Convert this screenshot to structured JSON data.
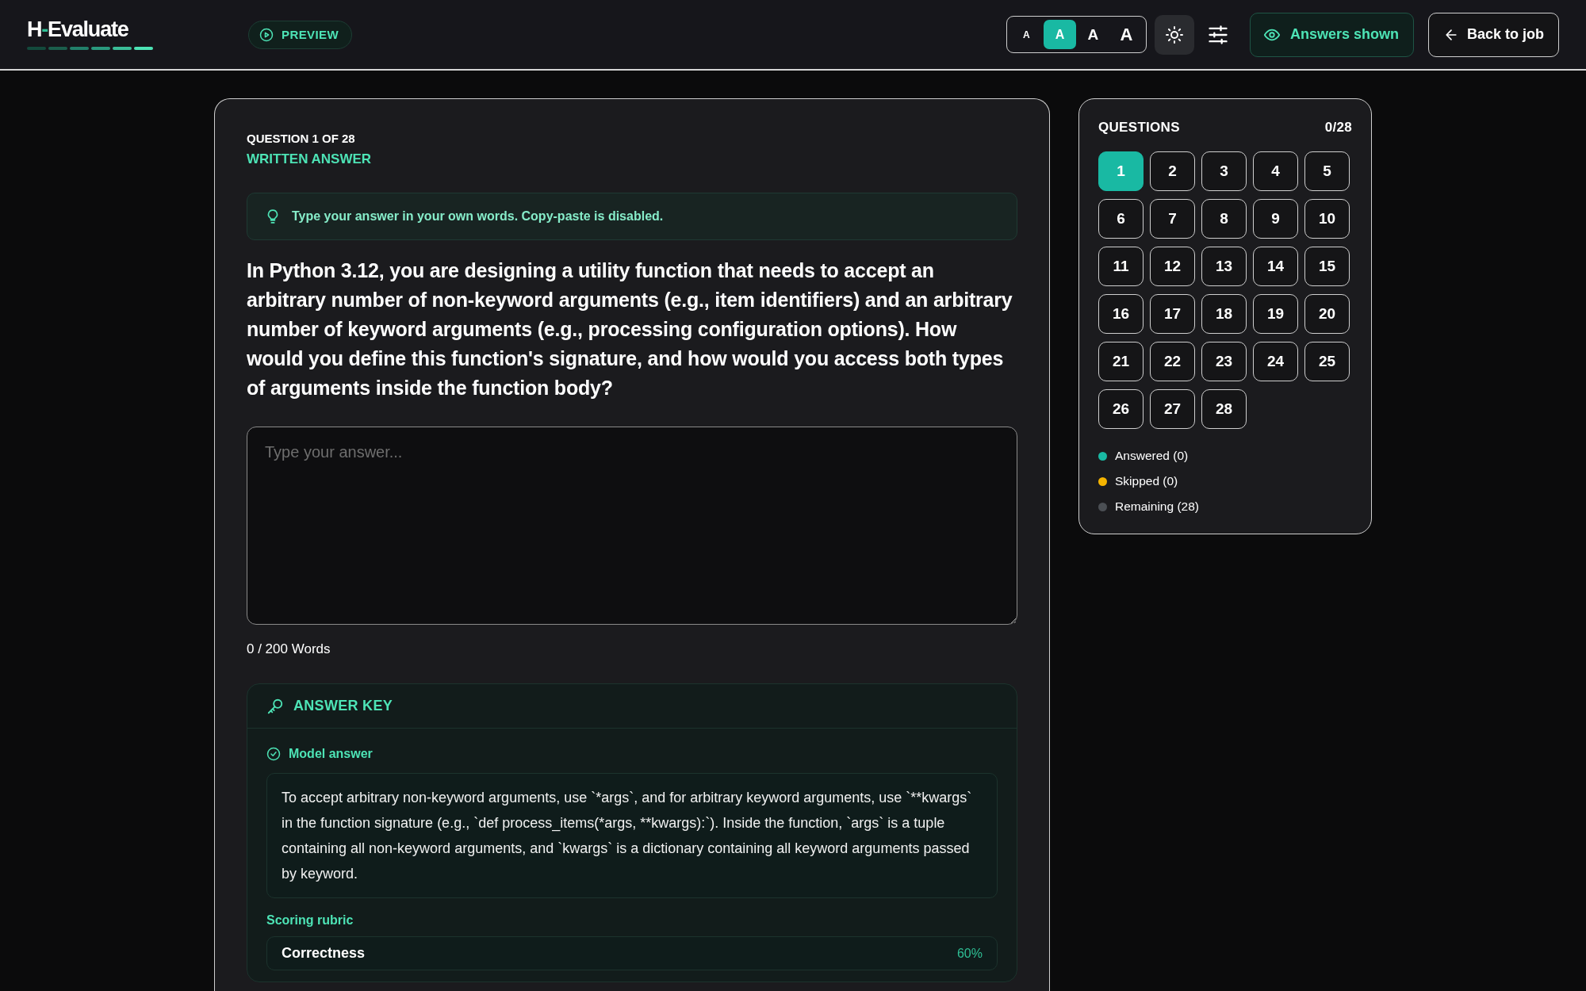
{
  "header": {
    "logo": {
      "prefix": "H",
      "separator": "-",
      "name": "Evaluate"
    },
    "preview_button": {
      "label": "PREVIEW"
    },
    "font_sizes": [
      {
        "label": "A",
        "selected": false
      },
      {
        "label": "A",
        "selected": true
      },
      {
        "label": "A",
        "selected": false
      },
      {
        "label": "A",
        "selected": false
      }
    ],
    "answers_toggle": {
      "label": "Answers shown",
      "on": true
    },
    "back_button": {
      "label": "Back to job"
    }
  },
  "question": {
    "counter": "QUESTION 1 OF 28",
    "type": "WRITTEN ANSWER",
    "hint": "Type your answer in your own words. Copy-paste is disabled.",
    "text": "In Python 3.12, you are designing a utility function that needs to accept an arbitrary number of non-keyword arguments (e.g., item identifiers) and an arbitrary number of keyword arguments (e.g., processing configuration options). How would you define this function's signature, and how would you access both types of arguments inside the function body?",
    "answer": {
      "placeholder": "Type your answer..."
    },
    "word_count": "0 / 200 Words"
  },
  "answer_key": {
    "title": "ANSWER KEY",
    "model_answer_label": "Model answer",
    "model_answer": "To accept arbitrary non-keyword arguments, use `*args`, and for arbitrary keyword arguments, use `**kwargs` in the function signature (e.g., `def process_items(*args, **kwargs):`). Inside the function, `args` is a tuple containing all non-keyword arguments, and `kwargs` is a dictionary containing all keyword arguments passed by keyword.",
    "rubric_label": "Scoring rubric",
    "rubric": [
      {
        "criterion": "Correctness",
        "weight": "60%"
      }
    ]
  },
  "navigator": {
    "title": "QUESTIONS",
    "progress": "0/28",
    "questions": [
      {
        "label": "1",
        "selected": true
      },
      {
        "label": "2",
        "selected": false
      },
      {
        "label": "3",
        "selected": false
      },
      {
        "label": "4",
        "selected": false
      },
      {
        "label": "5",
        "selected": false
      },
      {
        "label": "6",
        "selected": false
      },
      {
        "label": "7",
        "selected": false
      },
      {
        "label": "8",
        "selected": false
      },
      {
        "label": "9",
        "selected": false
      },
      {
        "label": "10",
        "selected": false
      },
      {
        "label": "11",
        "selected": false
      },
      {
        "label": "12",
        "selected": false
      },
      {
        "label": "13",
        "selected": false
      },
      {
        "label": "14",
        "selected": false
      },
      {
        "label": "15",
        "selected": false
      },
      {
        "label": "16",
        "selected": false
      },
      {
        "label": "17",
        "selected": false
      },
      {
        "label": "18",
        "selected": false
      },
      {
        "label": "19",
        "selected": false
      },
      {
        "label": "20",
        "selected": false
      },
      {
        "label": "21",
        "selected": false
      },
      {
        "label": "22",
        "selected": false
      },
      {
        "label": "23",
        "selected": false
      },
      {
        "label": "24",
        "selected": false
      },
      {
        "label": "25",
        "selected": false
      },
      {
        "label": "26",
        "selected": false
      },
      {
        "label": "27",
        "selected": false
      },
      {
        "label": "28",
        "selected": false
      }
    ],
    "legend": [
      {
        "label": "Answered (0)",
        "color": "#19b9a3"
      },
      {
        "label": "Skipped (0)",
        "color": "#f5b400"
      },
      {
        "label": "Remaining (28)",
        "color": "#4b4f54"
      }
    ]
  }
}
